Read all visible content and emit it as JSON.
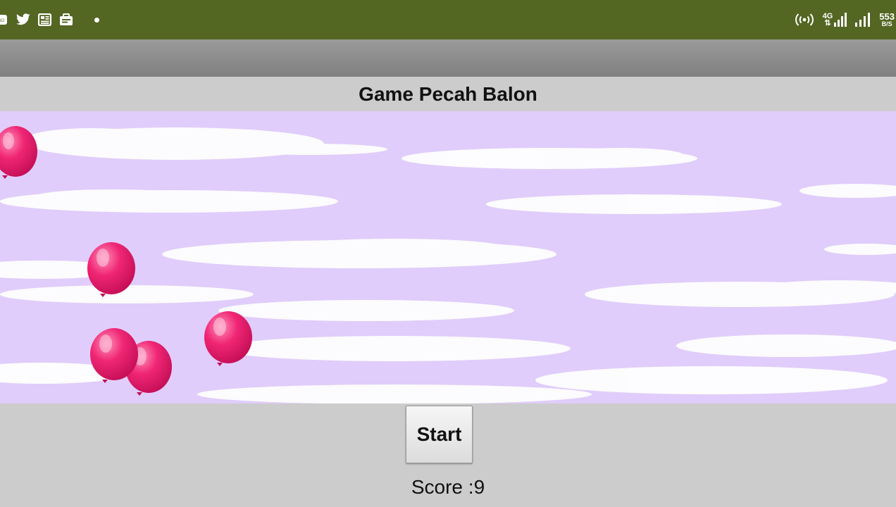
{
  "status_bar": {
    "left_icons": [
      "notification-icon",
      "twitter-icon",
      "news-icon",
      "briefcase-icon",
      "dot-icon"
    ],
    "right_icons": [
      "hotspot-icon",
      "signal-icon",
      "signal-icon"
    ],
    "network_label_top": "4G",
    "network_label_bottom": "⇅",
    "speed_value": "553",
    "speed_unit": "B/S",
    "background_color": "#536622"
  },
  "header": {
    "title": "Game Pecah Balon"
  },
  "game": {
    "sky_color": "#e0cdfb",
    "balloon_color": "#e91e63",
    "balloon_count": 5
  },
  "controls": {
    "start_label": "Start",
    "score_label": "Score :",
    "score_value": "9"
  }
}
